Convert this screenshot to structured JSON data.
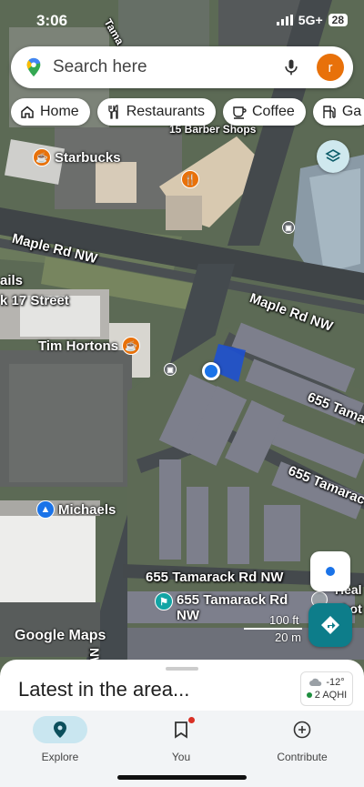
{
  "status_bar": {
    "time": "3:06",
    "network": "5G+",
    "battery": "28"
  },
  "search": {
    "placeholder": "Search here",
    "avatar_letter": "r"
  },
  "chips": [
    {
      "label": "Home",
      "icon": "home-icon"
    },
    {
      "label": "Restaurants",
      "icon": "fork-knife-icon"
    },
    {
      "label": "Coffee",
      "icon": "coffee-cup-icon"
    },
    {
      "label": "Ga",
      "icon": "gas-pump-icon"
    }
  ],
  "map": {
    "labels": {
      "barber": "15 Barber Shops",
      "maple1": "Maple Rd NW",
      "maple2": "Maple Rd NW",
      "tama_top": "Tama",
      "tamarack_655_a": "655 Tama",
      "tamarack_655_b": "655 Tamarac",
      "tamarack_655_c": "655 Tamarack Rd NW",
      "nails": "ails",
      "street17": "k 17 Street",
      "rd_nw_vertical": "NW Rd",
      "heal": "Heal",
      "hot": "hot",
      "ga": "Ga"
    },
    "pois": {
      "starbucks": "Starbucks",
      "tim_hortons": "Tim Hortons",
      "michaels": "Michaels",
      "address_line1": "655 Tamarack Rd",
      "address_line2": "NW"
    },
    "attribution": "Google Maps",
    "scale": {
      "ft": "100 ft",
      "m": "20 m"
    }
  },
  "sheet": {
    "title": "Latest in the area...",
    "weather_temp": "-12°",
    "air_quality": "2 AQHI"
  },
  "nav": {
    "explore": "Explore",
    "you": "You",
    "contribute": "Contribute"
  },
  "colors": {
    "accent": "#0d7d8a",
    "avatar": "#e8710a",
    "location_dot": "#1a73e8",
    "poi_orange": "#e8710a",
    "poi_blue": "#1a73e8",
    "poi_teal": "#12a4a4"
  }
}
